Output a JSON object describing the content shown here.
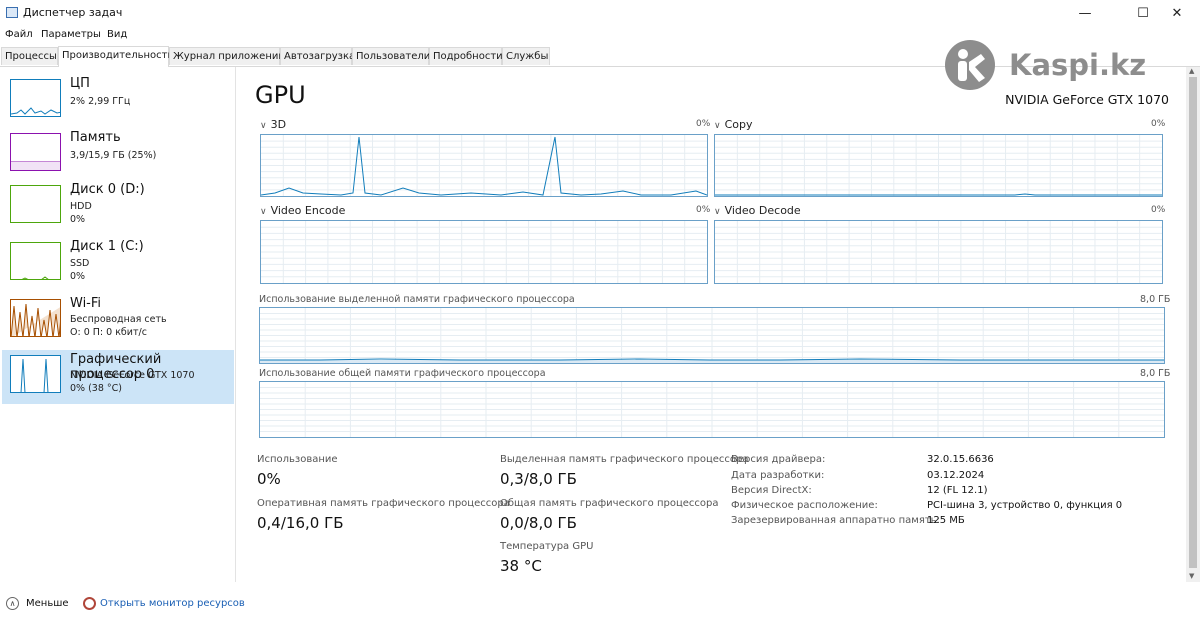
{
  "window": {
    "title": "Диспетчер задач",
    "minimize": "—",
    "maximize": "☐",
    "close": "✕"
  },
  "menu": [
    "Файл",
    "Параметры",
    "Вид"
  ],
  "tabs": [
    "Процессы",
    "Производительность",
    "Журнал приложений",
    "Автозагрузка",
    "Пользователи",
    "Подробности",
    "Службы"
  ],
  "active_tab": "Производительность",
  "watermark": {
    "text": "Kaspi.kz",
    "icon": "kaspi-logo-icon"
  },
  "sidebar": [
    {
      "title": "ЦП",
      "sub1": "2% 2,99 ГГц",
      "sub2": "",
      "color": "#117dbb"
    },
    {
      "title": "Память",
      "sub1": "3,9/15,9 ГБ (25%)",
      "sub2": "",
      "color": "#8b12ae"
    },
    {
      "title": "Диск 0 (D:)",
      "sub1": "HDD",
      "sub2": "0%",
      "color": "#4da60c"
    },
    {
      "title": "Диск 1 (C:)",
      "sub1": "SSD",
      "sub2": "0%",
      "color": "#4da60c"
    },
    {
      "title": "Wi-Fi",
      "sub1": "Беспроводная сеть",
      "sub2": "О: 0 П: 0 кбит/с",
      "color": "#a74f01"
    },
    {
      "title": "Графический процессор 0",
      "sub1": "NVIDIA GeForce GTX 1070",
      "sub2": "0% (38 °C)",
      "color": "#117dbb"
    }
  ],
  "main": {
    "title": "GPU",
    "model": "NVIDIA GeForce GTX 1070",
    "graphs": [
      {
        "label": "3D",
        "pct": "0%"
      },
      {
        "label": "Copy",
        "pct": "0%"
      },
      {
        "label": "Video Encode",
        "pct": "0%"
      },
      {
        "label": "Video Decode",
        "pct": "0%"
      }
    ],
    "dedicated_label": "Использование выделенной памяти графического процессора",
    "dedicated_max": "8,0 ГБ",
    "shared_label": "Использование общей памяти графического процессора",
    "shared_max": "8,0 ГБ",
    "stats": {
      "usage_label": "Использование",
      "usage_value": "0%",
      "gpu_mem_label": "Оперативная память графического процессора",
      "gpu_mem_value": "0,4/16,0 ГБ",
      "dedicated_label": "Выделенная память графического процессора",
      "dedicated_value": "0,3/8,0 ГБ",
      "shared_label": "Общая память графического процессора",
      "shared_value": "0,0/8,0 ГБ",
      "temp_label": "Температура GPU",
      "temp_value": "38 °C"
    },
    "info": [
      {
        "label": "Версия драйвера:",
        "value": "32.0.15.6636"
      },
      {
        "label": "Дата разработки:",
        "value": "03.12.2024"
      },
      {
        "label": "Версия DirectX:",
        "value": "12 (FL 12.1)"
      },
      {
        "label": "Физическое расположение:",
        "value": "PCI-шина 3, устройство 0, функция 0"
      },
      {
        "label": "Зарезервированная аппаратно память:",
        "value": "125 МБ"
      }
    ]
  },
  "footer": {
    "less": "Меньше",
    "monitor": "Открыть монитор ресурсов"
  },
  "colors": {
    "accent": "#117dbb",
    "selected": "#cce4f7",
    "graph_border": "#6aa0c8",
    "grid": "#e6edf2"
  }
}
